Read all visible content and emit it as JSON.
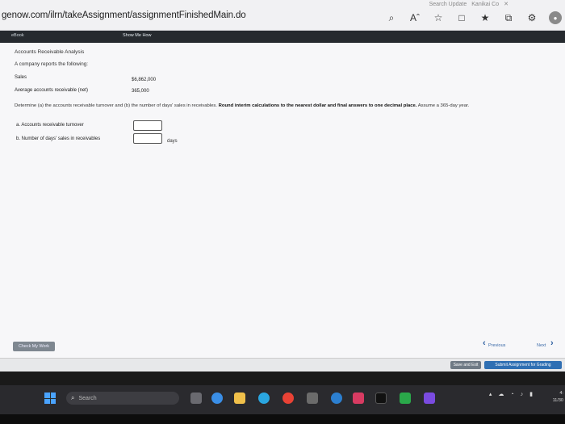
{
  "browser": {
    "url": "genow.com/ilrn/takeAssignment/assignmentFinishedMain.do",
    "tabs": [
      "Search Update",
      "Kanikai Co"
    ],
    "icons": [
      "zoom-icon",
      "read-aloud-icon",
      "favorite-icon",
      "split-screen-icon",
      "favorites-icon",
      "collections-icon",
      "extensions-icon",
      "profile-icon"
    ]
  },
  "header": {
    "ebook": "eBook",
    "show_me_how": "Show Me How"
  },
  "problem": {
    "title": "Accounts Receivable Analysis",
    "intro": "A company reports the following:",
    "rows": [
      {
        "label": "Sales",
        "value": "$6,862,000"
      },
      {
        "label": "Average accounts receivable (net)",
        "value": "365,000"
      }
    ],
    "instructions_plain": "Determine (a) the accounts receivable turnover and (b) the number of days' sales in receivables. ",
    "instructions_bold": "Round interim calculations to the nearest dollar and final answers to one decimal place.",
    "instructions_tail": " Assume a 365-day year.",
    "questions": [
      {
        "label": "a.  Accounts receivable turnover",
        "value": "",
        "unit": ""
      },
      {
        "label": "b.  Number of days' sales in receivables",
        "value": "",
        "unit": "days"
      }
    ]
  },
  "footer": {
    "check_my_work": "Check My Work",
    "previous": "Previous",
    "next": "Next",
    "save_exit": "Save and Exit",
    "submit": "Submit Assignment for Grading"
  },
  "taskbar": {
    "search_placeholder": "Search",
    "clock_line1": "4:",
    "clock_line2": "11/30"
  },
  "colors": {
    "accent": "#2f6fb3",
    "header": "#262a2f"
  }
}
